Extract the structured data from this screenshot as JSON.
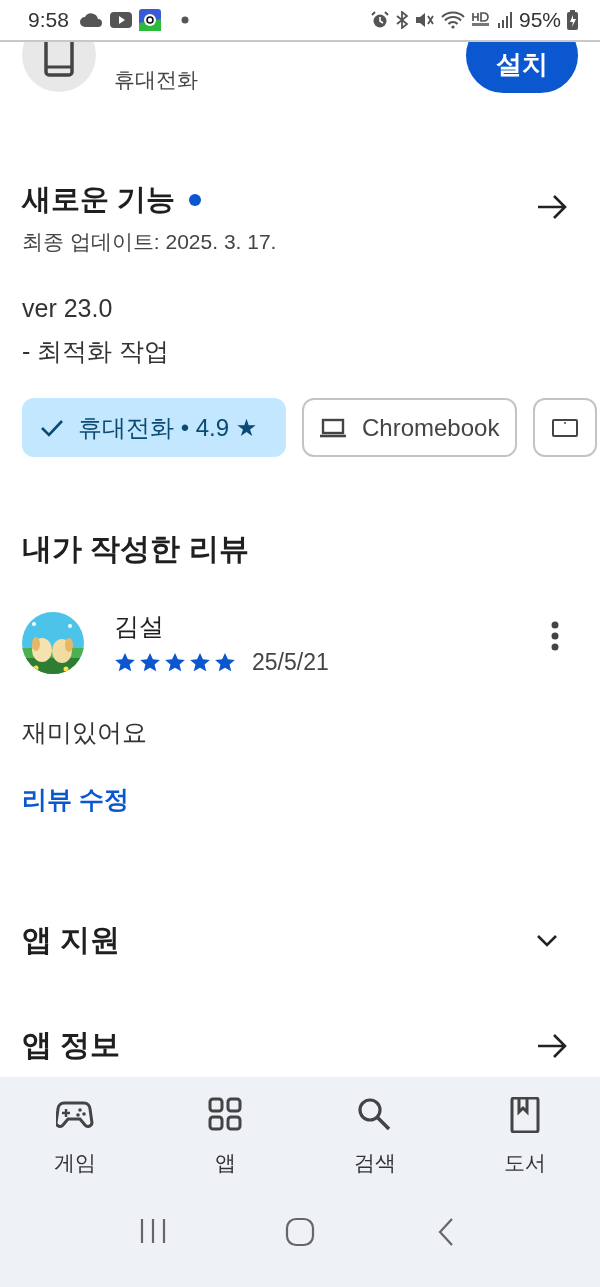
{
  "status_bar": {
    "time": "9:58",
    "battery": "95%"
  },
  "app_header": {
    "subtitle": "휴대전화",
    "install_button": "설치"
  },
  "whats_new": {
    "title": "새로운 기능",
    "unread": true,
    "updated": "최종 업데이트: 2025. 3. 17.",
    "version": "ver 23.0",
    "notes": "- 최적화 작업"
  },
  "device_chips": [
    {
      "kind": "phone",
      "label": "휴대전화 • 4.9 ★",
      "selected": true
    },
    {
      "kind": "laptop",
      "label": "Chromebook",
      "selected": false
    },
    {
      "kind": "tablet",
      "selected": false
    }
  ],
  "my_review": {
    "heading": "내가 작성한 리뷰",
    "reviewer": "김설",
    "stars": 5,
    "date": "25/5/21",
    "text": "재미있어요",
    "edit_link": "리뷰 수정"
  },
  "sections": [
    {
      "kind": "expand",
      "title": "앱 지원"
    },
    {
      "kind": "link",
      "title": "앱 정보"
    }
  ],
  "bottom_nav": [
    {
      "kind": "games",
      "label": "게임"
    },
    {
      "kind": "apps",
      "label": "앱"
    },
    {
      "kind": "search",
      "label": "검색"
    },
    {
      "kind": "books",
      "label": "도서"
    }
  ]
}
